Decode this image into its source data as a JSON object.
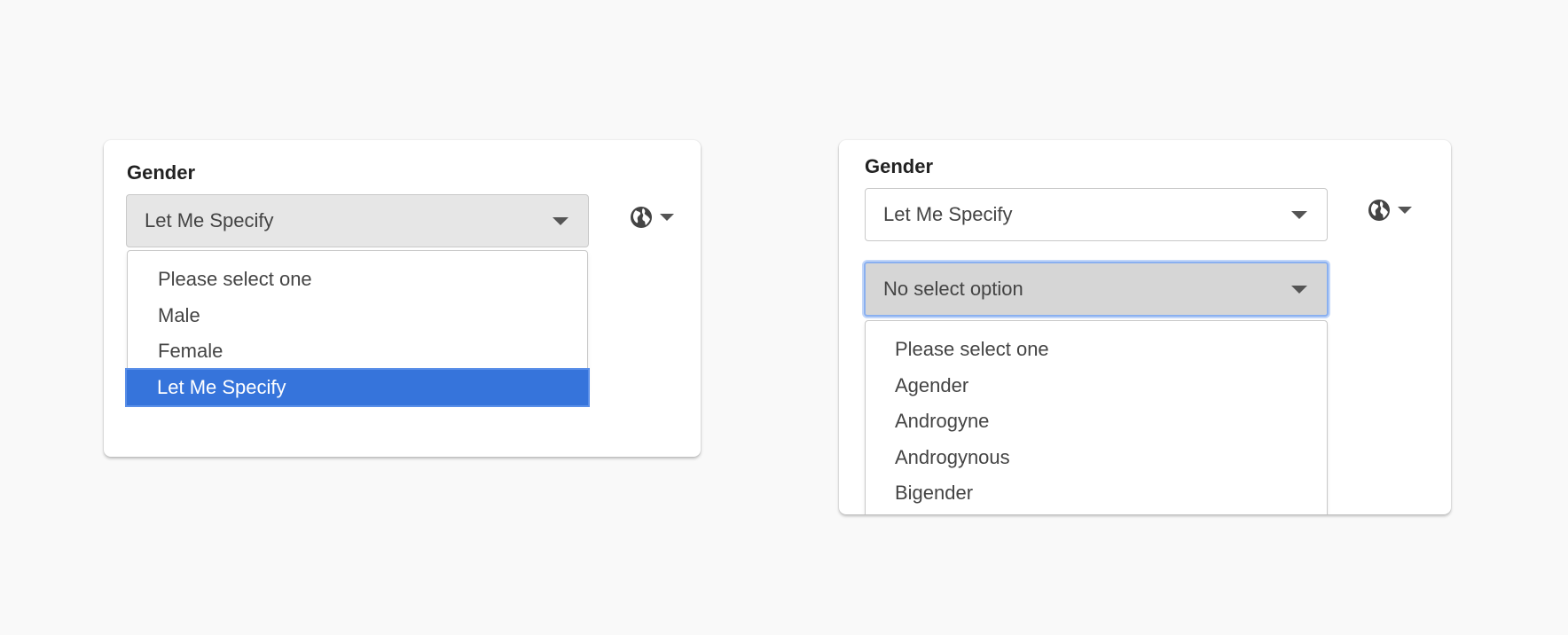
{
  "left_panel": {
    "label": "Gender",
    "select_value": "Let Me Specify",
    "options": [
      {
        "label": "Please select one",
        "selected": false
      },
      {
        "label": "Male",
        "selected": false
      },
      {
        "label": "Female",
        "selected": false
      },
      {
        "label": "Let Me Specify",
        "selected": true
      }
    ],
    "globe_icon": "globe-icon"
  },
  "right_panel": {
    "label": "Gender",
    "select_value": "Let Me Specify",
    "secondary_select_value": "No select option",
    "options": [
      {
        "label": "Please select one"
      },
      {
        "label": "Agender"
      },
      {
        "label": "Androgyne"
      },
      {
        "label": "Androgynous"
      },
      {
        "label": "Bigender"
      }
    ],
    "globe_icon": "globe-icon"
  },
  "colors": {
    "selected_option_bg": "#3674db",
    "focus_ring": "#8ab0f0",
    "page_background": "#f9f9f9"
  }
}
